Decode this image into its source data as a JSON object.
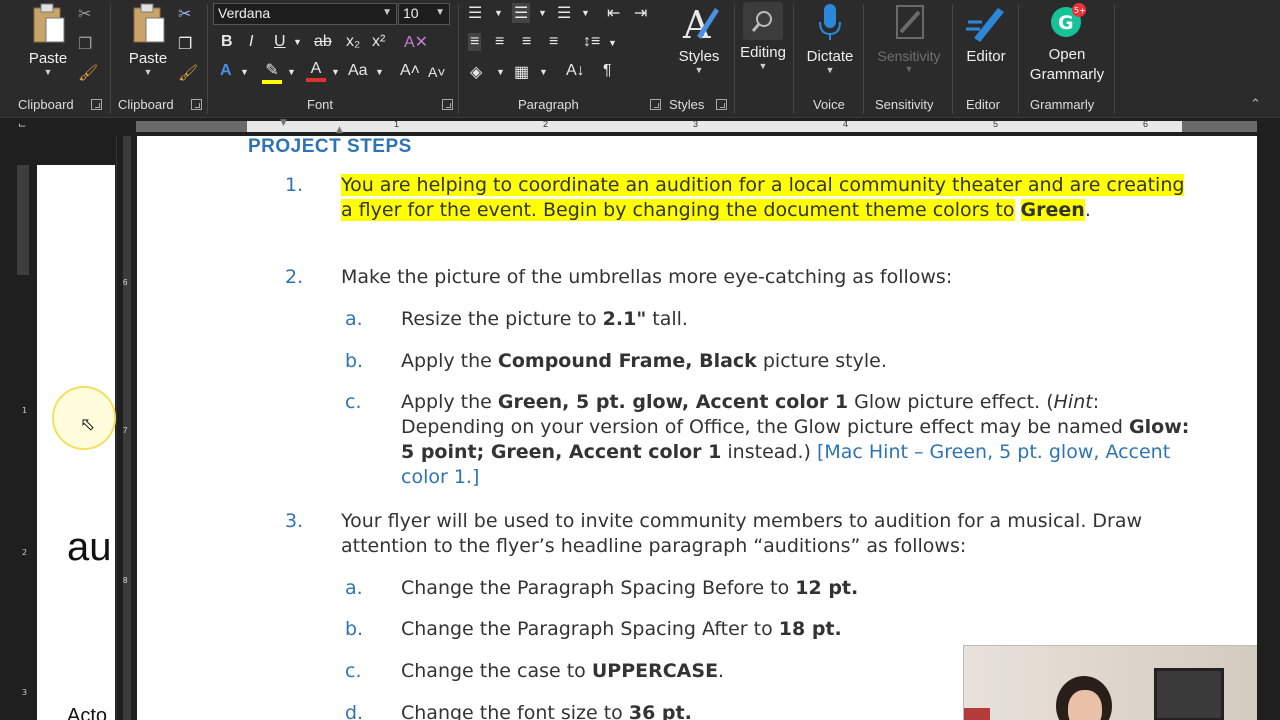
{
  "ribbon": {
    "clipboard_left": {
      "paste": "Paste",
      "group": "Clipboard"
    },
    "clipboard_right": {
      "paste": "Paste",
      "group": "Clipboard"
    },
    "font": {
      "name": "Verdana",
      "size": "10",
      "group": "Font",
      "bold": "B",
      "italic": "I",
      "underline": "U",
      "strike": "ab",
      "subscript": "x₂",
      "superscript": "x²",
      "case": "Aa",
      "grow": "A˄",
      "shrink": "A˅"
    },
    "paragraph": {
      "group": "Paragraph",
      "pilcrow": "¶"
    },
    "styles": {
      "label": "Styles",
      "group": "Styles"
    },
    "editing": {
      "label": "Editing"
    },
    "voice": {
      "label": "Dictate",
      "group": "Voice"
    },
    "sensitivity": {
      "label": "Sensitivity",
      "group": "Sensitivity"
    },
    "editor": {
      "label": "Editor",
      "group": "Editor"
    },
    "grammarly": {
      "label_line1": "Open",
      "label_line2": "Grammarly",
      "group": "Grammarly",
      "badge": "5+"
    },
    "accent_color": "#2e74b5",
    "highlight_color": "#ffff00"
  },
  "ruler": {
    "h_numbers": [
      "1",
      "2",
      "3",
      "4",
      "5",
      "6"
    ],
    "v_numbers": [
      "6",
      "7",
      "8"
    ],
    "left_v_numbers": [
      "1",
      "2",
      "3"
    ]
  },
  "left_pane": {
    "thumb_text": "au",
    "thumb_text2": "Acto"
  },
  "document": {
    "heading": "PROJECT STEPS",
    "steps": [
      {
        "num": "1.",
        "text_hl": "You are helping to coordinate an audition for a local community theater and are creating a flyer for the event. Begin by changing the document theme colors to",
        "bold_hl": "Green",
        "after": "."
      },
      {
        "num": "2.",
        "text": "Make the picture of the umbrellas more eye-catching as follows:",
        "subs": [
          {
            "num": "a.",
            "pre": "Resize the picture to ",
            "bold": "2.1\"",
            "post": " tall."
          },
          {
            "num": "b.",
            "pre": "Apply the ",
            "bold": "Compound Frame, Black",
            "post": " picture style."
          },
          {
            "num": "c.",
            "pre": "Apply the ",
            "bold": "Green, 5 pt. glow, Accent color 1",
            "post": " Glow picture effect. (",
            "italic": "Hint",
            "post2": ": Depending on your version of Office, the Glow picture effect may be named ",
            "bold2": "Glow: 5 point; Green, Accent color 1",
            "post3": " instead.) ",
            "link": "[Mac Hint – Green, 5 pt. glow, Accent color 1.]"
          }
        ]
      },
      {
        "num": "3.",
        "text": "Your flyer will be used to invite community members to audition for a musical. Draw attention to the flyer’s headline paragraph “auditions” as follows:",
        "subs": [
          {
            "num": "a.",
            "pre": "Change the Paragraph Spacing Before to ",
            "bold": "12 pt."
          },
          {
            "num": "b.",
            "pre": "Change the Paragraph Spacing After to ",
            "bold": "18 pt."
          },
          {
            "num": "c.",
            "pre": "Change the case to ",
            "bold": "UPPERCASE",
            "post": "."
          },
          {
            "num": "d.",
            "pre": "Change the font size to ",
            "bold": "36 pt."
          }
        ]
      }
    ]
  }
}
